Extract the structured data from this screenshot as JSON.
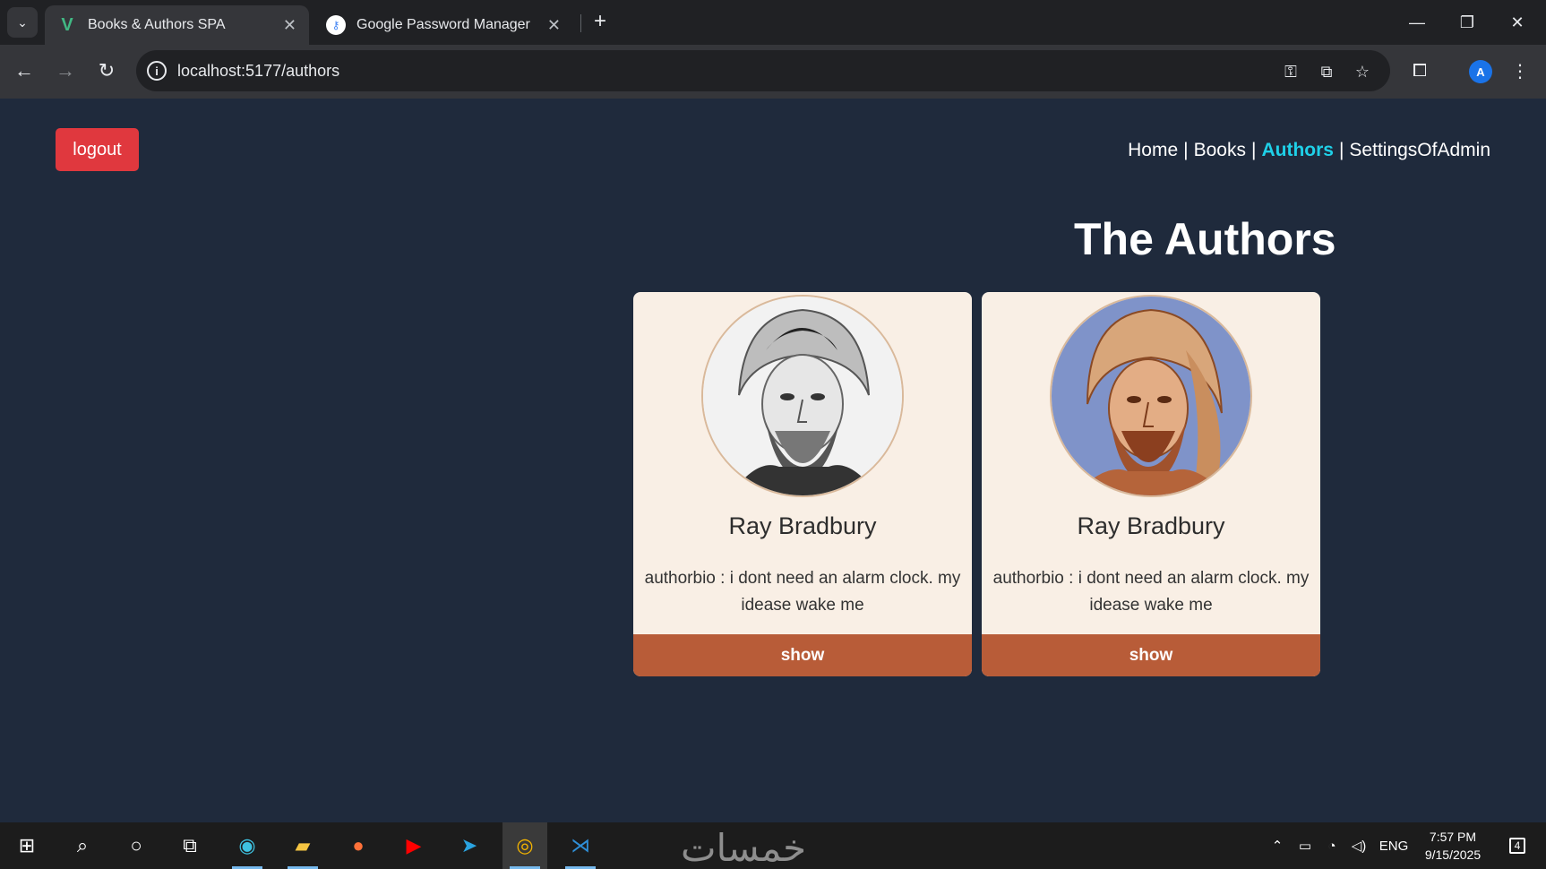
{
  "browser": {
    "tabs": [
      {
        "title": "Books & Authors SPA",
        "favicon": "vue-icon",
        "active": true
      },
      {
        "title": "Google Password Manager",
        "favicon": "google-password-manager-icon",
        "active": false
      }
    ],
    "url": "localhost:5177/authors",
    "profile_initial": "A"
  },
  "app": {
    "logout_label": "logout",
    "nav": {
      "home": "Home",
      "books": "Books",
      "authors": "Authors",
      "settings": "SettingsOfAdmin",
      "separator": "|"
    },
    "heading": "The Authors",
    "authors": [
      {
        "name": "Ray Bradbury",
        "bio": "authorbio : i dont need an alarm clock. my idease wake me",
        "button": "show"
      },
      {
        "name": "Ray Bradbury",
        "bio": "authorbio : i dont need an alarm clock. my idease wake me",
        "button": "show"
      }
    ]
  },
  "taskbar": {
    "watermark": "خمسات",
    "language": "ENG",
    "time": "7:57 PM",
    "date": "9/15/2025",
    "notifications_count": "4"
  },
  "colors": {
    "page_bg": "#1f2a3c",
    "logout_bg": "#e0383e",
    "active_nav": "#1fd0e8",
    "card_bg": "#f9efe5",
    "show_button_bg": "#b85c38"
  }
}
